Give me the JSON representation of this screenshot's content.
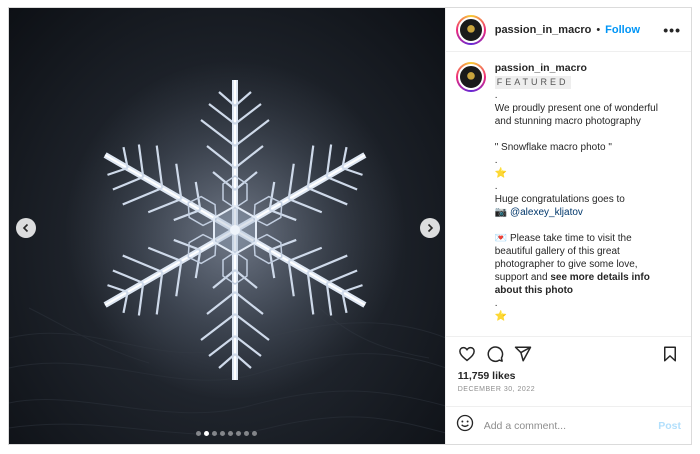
{
  "post": {
    "username": "passion_in_macro",
    "separator": "•",
    "follow_label": "Follow",
    "more_label": "•••",
    "image_alt": "Snowflake macro photo"
  },
  "carousel": {
    "prev_label": "‹",
    "next_label": "›",
    "slide_count": 8,
    "active_index": 1
  },
  "caption": {
    "username": "passion_in_macro",
    "featured": "FEATURED",
    "dot1": ".",
    "line1": "We proudly present one of wonderful and stunning macro photography",
    "title": "\" Snowflake macro photo \"",
    "dot2": ".",
    "star1": "⭐",
    "dot3": ".",
    "congrats": "Huge congratulations goes to",
    "camera_emoji": "📷",
    "mention": "@alexey_kljatov",
    "heart_emoji": "💌",
    "visit_text": "Please take time to visit the beautiful gallery of this great photographer to give some love, support and",
    "see_more": "see more details info about this photo",
    "dot4": ".",
    "star2": "⭐"
  },
  "actions": {
    "like_icon": "heart-outline",
    "comment_icon": "speech-bubble",
    "share_icon": "paper-plane",
    "save_icon": "bookmark"
  },
  "likes": "11,759 likes",
  "date": "DECEMBER 30, 2022",
  "comment": {
    "placeholder": "Add a comment...",
    "post_label": "Post",
    "emoji_icon": "smiley"
  },
  "colors": {
    "accent": "#0095f6",
    "post_disabled": "#b2dffc",
    "muted": "#8e8e8e",
    "border": "#dbdbdb"
  }
}
